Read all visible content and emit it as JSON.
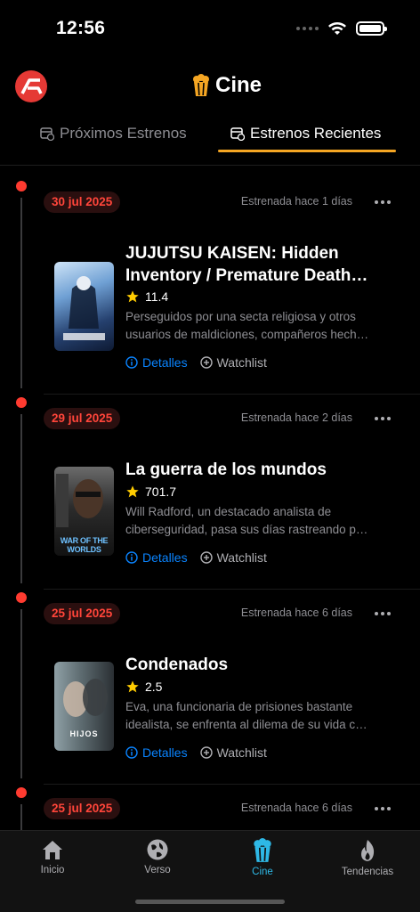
{
  "status": {
    "time": "12:56"
  },
  "header": {
    "title": "Cine"
  },
  "tabs": [
    {
      "label": "Próximos Estrenos",
      "active": false
    },
    {
      "label": "Estrenos Recientes",
      "active": true
    }
  ],
  "movies": [
    {
      "date": "30 jul 2025",
      "released": "Estrenada hace 1 días",
      "title_line1": "JUJUTSU KAISEN: Hidden",
      "title_line2": "Inventory / Premature Death…",
      "rating": "11.4",
      "desc_line1": "Perseguidos por una secta religiosa y otros",
      "desc_line2": "usuarios de maldiciones, compañeros hech…",
      "details_label": "Detalles",
      "watchlist_label": "Watchlist"
    },
    {
      "date": "29 jul 2025",
      "released": "Estrenada hace 2 días",
      "title_line1": "La guerra de los mundos",
      "rating": "701.7",
      "desc_line1": "Will Radford, un destacado analista de",
      "desc_line2": "ciberseguridad, pasa sus días rastreando p…",
      "poster_text": "WAR OF THE WORLDS",
      "details_label": "Detalles",
      "watchlist_label": "Watchlist"
    },
    {
      "date": "25 jul 2025",
      "released": "Estrenada hace 6 días",
      "title_line1": "Condenados",
      "rating": "2.5",
      "desc_line1": "Eva, una funcionaria de prisiones bastante",
      "desc_line2": "idealista, se enfrenta al dilema de su vida c…",
      "poster_text": "HIJOS",
      "details_label": "Detalles",
      "watchlist_label": "Watchlist"
    },
    {
      "date": "25 jul 2025",
      "released": "Estrenada hace 6 días"
    }
  ],
  "nav": [
    {
      "label": "Inicio",
      "icon": "home-icon"
    },
    {
      "label": "Verso",
      "icon": "globe-icon"
    },
    {
      "label": "Cine",
      "icon": "popcorn-icon",
      "active": true
    },
    {
      "label": "Tendencias",
      "icon": "flame-icon"
    }
  ],
  "colors": {
    "accent": "#f5a623",
    "date": "#ff453a",
    "link": "#0a84ff",
    "nav_active": "#2eb8e6"
  }
}
